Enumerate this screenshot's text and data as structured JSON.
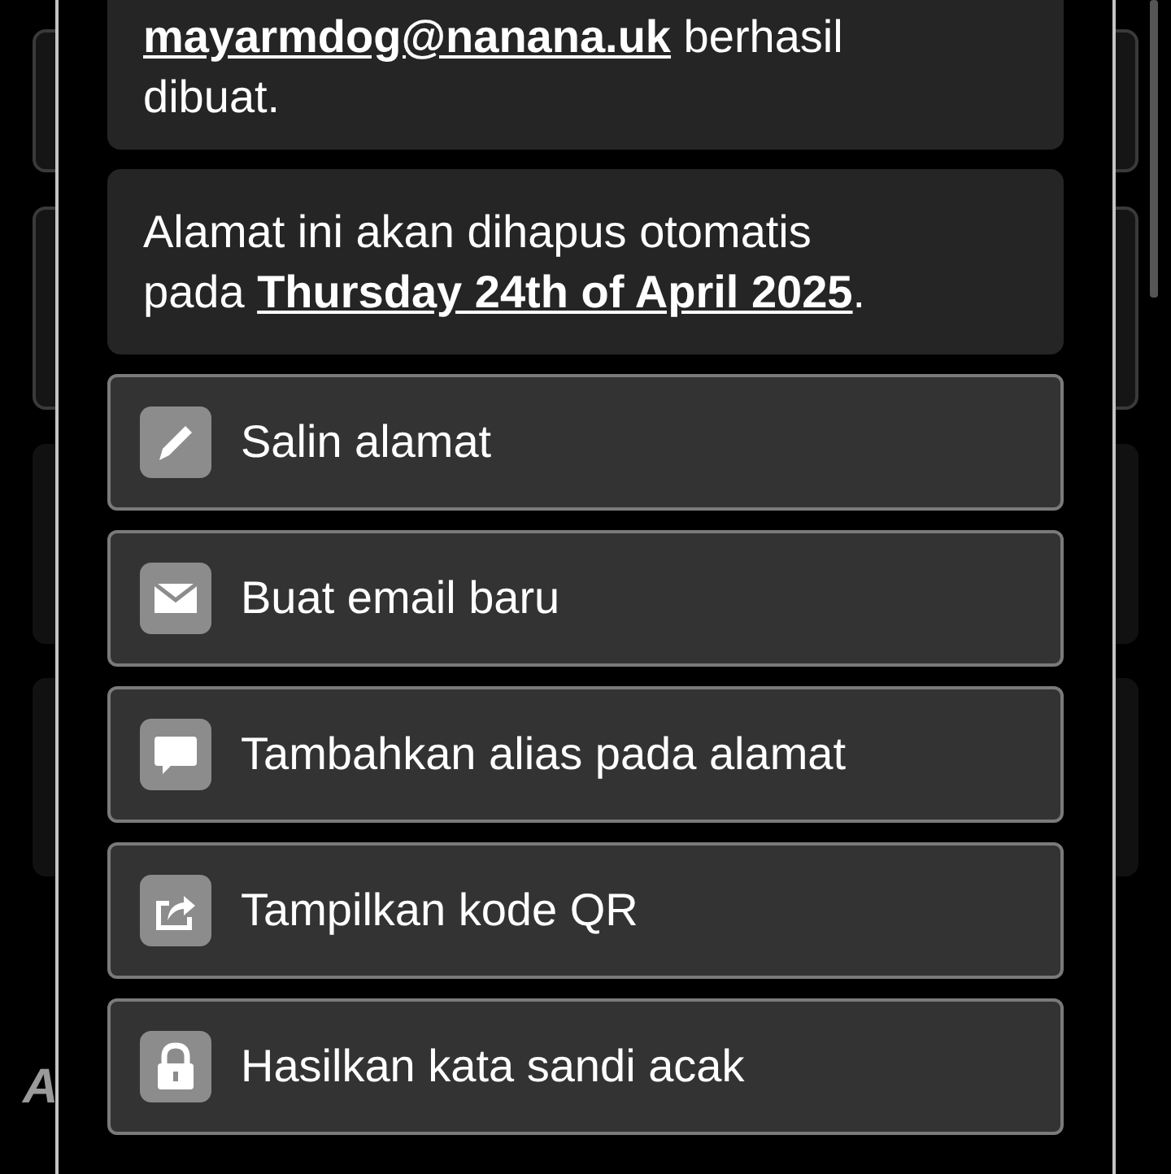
{
  "background": {
    "cards": [
      {
        "kind": "outlined"
      },
      {
        "kind": "outlined"
      },
      {
        "kind": "plain"
      },
      {
        "kind": "plain"
      }
    ],
    "heading": "A"
  },
  "dialog": {
    "created_message": {
      "email": "mayarmdog@nanana.uk",
      "text": "berhasil dibuat."
    },
    "expiry_message": "Alamat ini akan dihapus otomatis pada **Thursday 24th of April 2025**.",
    "actions": [
      {
        "label": "Salin alamat"
      },
      {
        "label": "Buat email baru"
      },
      {
        "label": "Tambahkan alias pada alamat"
      },
      {
        "label": "Tampilkan kode QR"
      },
      {
        "label": "Hasilkan kata sandi acak"
      }
    ]
  }
}
